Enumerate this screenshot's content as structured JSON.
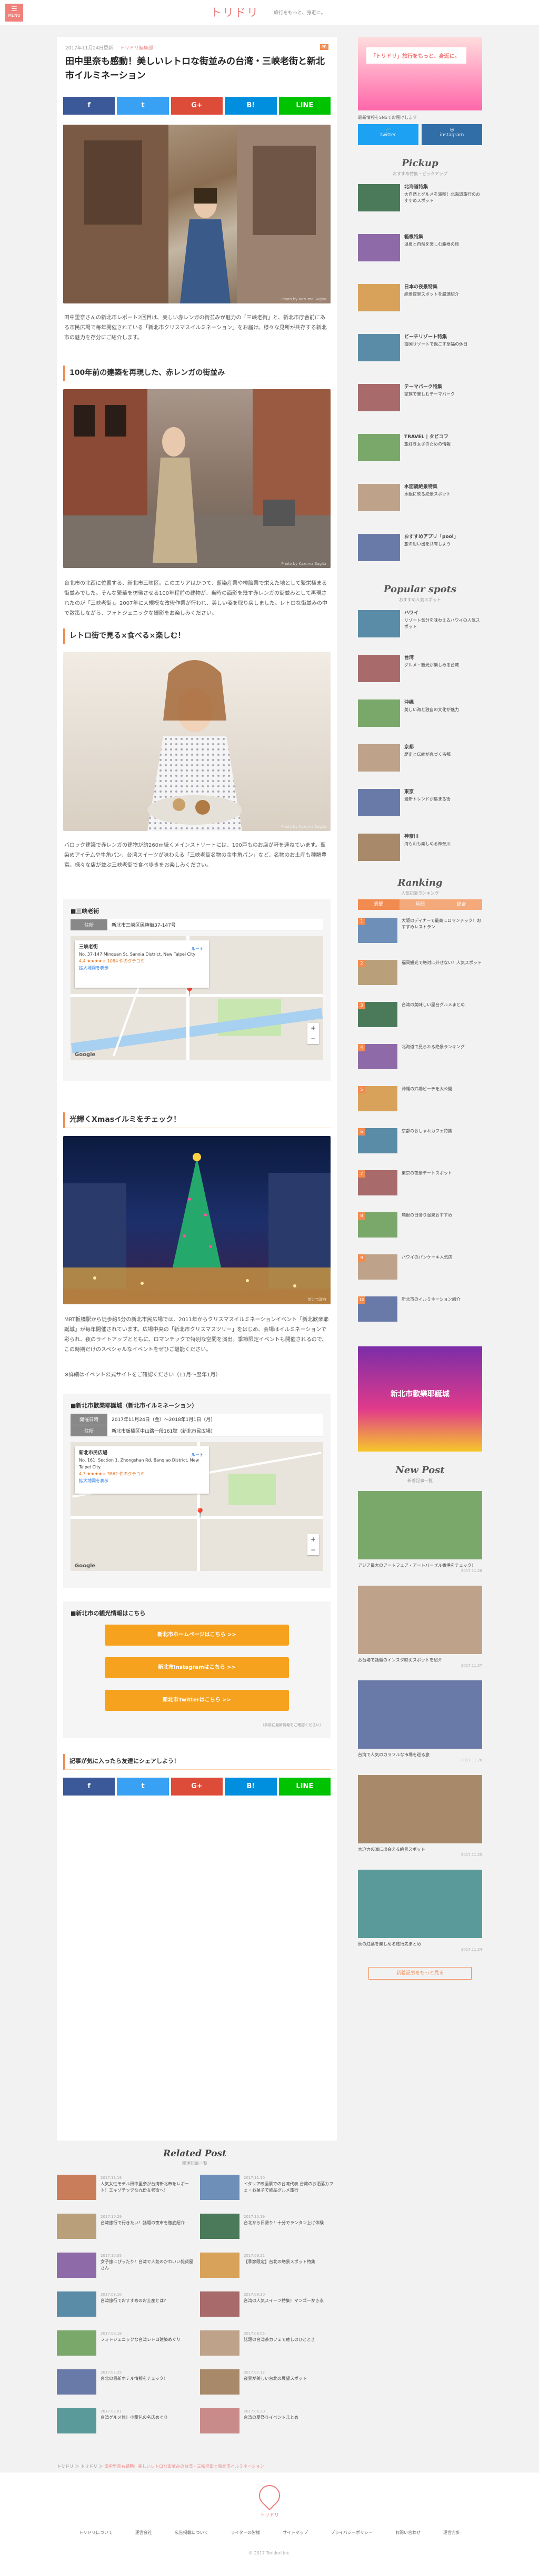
{
  "header": {
    "menu_label": "MENU",
    "logo": "トリドリ",
    "tagline": "旅行をもっと、身近に。"
  },
  "article": {
    "date": "2017年11月24日更新",
    "category": "トリドリ編集部",
    "pr_badge": "PR",
    "title": "田中里奈も感動！美しいレトロな街並みの台湾・三峡老街と新北市イルミネーション",
    "intro": "田中里奈さんの新北市レポート2回目は、美しい赤レンガの街並みが魅力の「三峡老街」と、新北市庁舎前にある市民広場で毎年開催されている「新北市クリスマスイルミネーション」をお届け。様々な見所が共存する新北市の魅力を存分にご紹介します。",
    "sections": [
      {
        "heading": "100年前の建築を再現した、赤レンガの街並み",
        "body": "台北市の北西に位置する、新北市三峡区。このエリアはかつて、藍染産業や樟脳業で栄えた地として繁栄極まる街並みでした。そんな繁華を彷彿させる100年程前の建物が、当時の面影を残す赤レンガの街並みとして再現されたのが「三峡老街」。2007年に大規模な改修作業が行われ、美しい姿を取り戻しました。レトロな街並みの中で散策しながら、フォトジェニックな撮影をお楽しみください。"
      },
      {
        "heading": "レトロ街で見る×食べる×楽しむ！",
        "body": "バロック建築で赤レンガの建物が約260m続くメインストリートには、100戸ものお店が軒を連ねています。藍染めアイテムや牛角パン、台湾スイーツが味わえる「三峡老街名物の金牛角パン」など、名物のお土産も種類豊富。様々な店が並ぶ三峡老街で食べ歩きをお楽しみください。"
      },
      {
        "heading": "光輝くXmasイルミをチェック！",
        "body": "MRT板橋駅から徒歩約5分の新北市民広場では、2011年からクリスマスイルミネーションイベント「新北歓楽耶誕城」が毎年開催されています。広場中央の「新北市クリスマスツリー」をはじめ、会場はイルミネーションで彩られ、夜のライトアップとともに、ロマンチックで特別な空間を演出。季節限定イベントも開催されるので、この時期だけのスペシャルなイベントをぜひご堪能ください。",
        "body2": "※詳細はイベント公式サイトをご確認ください（11月〜翌年1月）"
      }
    ],
    "photo_credits": [
      "Photo by Kazuma Sugita",
      "Photo by Kazuma Sugita",
      "Photo by Kazuma Sugita",
      "新北市政府"
    ],
    "info1": {
      "title": "■三峡老街",
      "rows": [
        {
          "k": "住所",
          "v": "新北市三峡区民権街37-147号"
        }
      ],
      "map": {
        "place": "三峡老街",
        "address": "No. 37-147 Minquan St, Sanxia District, New Taipei City",
        "rating": "4.4 ★★★★☆ 1084 件のクチコミ",
        "larger": "拡大地図を表示",
        "directions": "ルート",
        "google": "Google"
      }
    },
    "info2": {
      "title": "■新北市歡樂耶誕城（新北市イルミネーション）",
      "rows": [
        {
          "k": "開催日時",
          "v": "2017年11月24日（金）〜2018年1月1日（月）"
        },
        {
          "k": "住所",
          "v": "新北市板橋区中山路一段161號（新北市民広場）"
        }
      ],
      "map": {
        "place": "新北市民広場",
        "address": "No. 161, Section 1, Zhongshan Rd, Banqiao District, New Taipei City",
        "rating": "4.3 ★★★★☆ 3862 件のクチコミ",
        "larger": "拡大地図を表示",
        "directions": "ルート",
        "google": "Google"
      }
    },
    "links": {
      "title": "■新北市の観光情報はこちら",
      "buttons": [
        "新北市ホームページはこちら >>",
        "新北市Instagramはこちら >>",
        "新北市Twitterはこちら >>"
      ],
      "note": "（事前に最新情報をご確認ください）"
    },
    "share_prompt": "記事が気に入ったら友達にシェアしよう！",
    "share": [
      "f",
      "t",
      "G+",
      "B!",
      "LINE"
    ]
  },
  "related": {
    "title": "Related Post",
    "subtitle": "関連記事一覧",
    "items": [
      {
        "date": "2017.11.18",
        "text": "人気女性モデル田中里奈が台湾新北市をレポート！エキゾチックな九份＆老街へ！"
      },
      {
        "date": "2017.11.10",
        "text": "イタリア映画祭での台湾代表 台湾のお洒落カフェ・お菓子で絶品グルメ旅行"
      },
      {
        "date": "2017.10.29",
        "text": "台湾旅行で行きたい！話題の夜市を徹底紹介"
      },
      {
        "date": "2017.10.19",
        "text": "台北から日帰り！十分でランタン上げ体験"
      },
      {
        "date": "2017.10.05",
        "text": "女子旅にぴったり！台湾で人気のかわいい雑貨屋さん"
      },
      {
        "date": "2017.09.22",
        "text": "【季節限定】台北の絶景スポット特集"
      },
      {
        "date": "2017.09.10",
        "text": "台湾旅行でおすすめのお土産とは？"
      },
      {
        "date": "2017.08.30",
        "text": "台湾の人気スイーツ特集！マンゴーかき氷"
      },
      {
        "date": "2017.08.18",
        "text": "フォトジェニックな台湾レトロ建築めぐり"
      },
      {
        "date": "2017.08.05",
        "text": "話題の台湾茶カフェで癒しのひととき"
      },
      {
        "date": "2017.07.25",
        "text": "台北の最新ホテル情報をチェック！"
      },
      {
        "date": "2017.07.12",
        "text": "夜景が美しい台北の展望スポット"
      },
      {
        "date": "2017.07.01",
        "text": "台湾グルメ旅！小籠包の名店めぐり"
      },
      {
        "date": "2017.06.20",
        "text": "台湾の夏祭りイベントまとめ"
      }
    ]
  },
  "sidebar": {
    "banner_text": "「トリドリ」旅行をもっと、身近に。",
    "follow_text": "最新情報をSNSでお届けします",
    "sns": [
      "twitter",
      "instagram"
    ],
    "pickup_title": "Pickup",
    "pickup_sub": "おすすめ特集・ピックアップ",
    "pickup": [
      {
        "title": "北海道特集",
        "text": "大自然とグルメを満喫！北海道旅行のおすすめスポット"
      },
      {
        "title": "箱根特集",
        "text": "温泉と自然を楽しむ箱根の旅"
      },
      {
        "title": "日本の夜景特集",
        "text": "絶景夜景スポットを厳選紹介"
      },
      {
        "title": "ビーチリゾート特集",
        "text": "南国リゾートで過ごす至福の休日"
      },
      {
        "title": "テーマパーク特集",
        "text": "家族で楽しむテーマパーク"
      },
      {
        "title": "TRAVEL | タビコフ",
        "text": "旅好き女子のための情報"
      },
      {
        "title": "水面鏡絶景特集",
        "text": "水鏡に映る絶景スポット"
      },
      {
        "title": "おすすめアプリ「pool」",
        "text": "旅の思い出を共有しよう"
      }
    ],
    "popular_title": "Popular spots",
    "popular_sub": "おすすめ人気スポット",
    "popular": [
      {
        "title": "ハワイ",
        "text": "リゾート気分を味わえるハワイの人気スポット"
      },
      {
        "title": "台湾",
        "text": "グルメ・観光が楽しめる台湾"
      },
      {
        "title": "沖縄",
        "text": "美しい海と独自の文化が魅力"
      },
      {
        "title": "京都",
        "text": "歴史と伝統が息づく古都"
      },
      {
        "title": "東京",
        "text": "最新トレンドが集まる街"
      },
      {
        "title": "神奈川",
        "text": "海も山も楽しめる神奈川"
      }
    ],
    "ranking_title": "Ranking",
    "ranking_sub": "人気記事ランキング",
    "ranking_tabs": [
      "週間",
      "月間",
      "総合"
    ],
    "ranking": [
      "大阪のディナーで最高にロマンチック！おすすめレストラン",
      "福岡観光で絶対に外せない！人気スポット",
      "台湾の美味しい屋台グルメまとめ",
      "北海道で見られる絶景ランキング",
      "沖縄の穴場ビーチを大公開",
      "京都のおしゃれカフェ特集",
      "東京の夜景デートスポット",
      "箱根の日帰り温泉おすすめ",
      "ハワイのパンケーキ人気店",
      "新北市のイルミネーション紹介"
    ],
    "ad_text": "新北市歡樂耶誕城",
    "newpost_title": "New Post",
    "newpost_sub": "新着記事一覧",
    "newposts": [
      {
        "text": "アジア最大のアートフェア・アートバーゼル香港をチェック！",
        "date": "2017.11.28"
      },
      {
        "text": "お台場で話題のインスタ映えスポットを紹介",
        "date": "2017.11.27"
      },
      {
        "text": "台湾で人気のカラフルな市場を巡る旅",
        "date": "2017.11.26"
      },
      {
        "text": "大迫力の滝に出会える絶景スポット",
        "date": "2017.11.25"
      },
      {
        "text": "秋の紅葉を楽しめる旅行先まとめ",
        "date": "2017.11.24"
      }
    ],
    "newpost_more": "新着記事をもっと見る"
  },
  "breadcrumb": {
    "home": "トリドリ",
    "cat": "トリドリ",
    "current": "田中里奈も感動！美しいレトロな街並みの台湾・三峡老街と新北市イルミネーション"
  },
  "footer": {
    "logo": "トリドリ",
    "nav": [
      "トリドリについて",
      "運営会社",
      "広告掲載について",
      "ライターの皆様",
      "サイトマップ",
      "プライバシーポリシー",
      "お問い合わせ",
      "運営方針"
    ],
    "copyright": "© 2017 Toridori Inc."
  }
}
